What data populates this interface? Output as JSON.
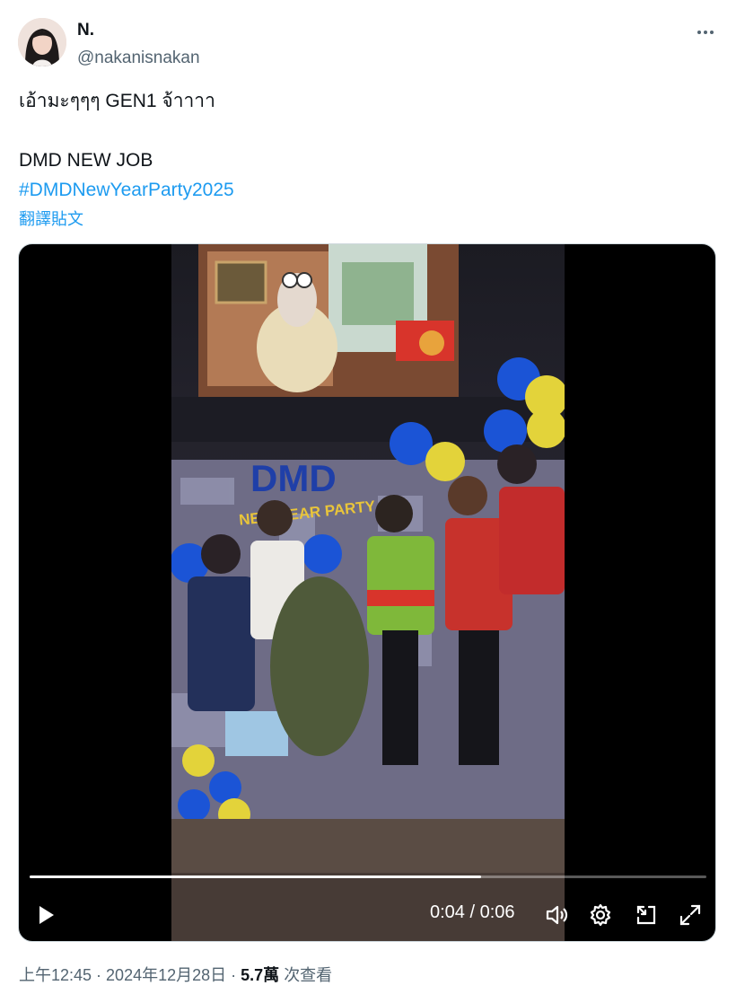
{
  "author": {
    "display_name": "N.",
    "handle": "@nakanisnakan"
  },
  "tweet": {
    "line1": "เอ้ามะๆๆๆ GEN1 จ้าาาา",
    "line2": "DMD NEW JOB",
    "hashtag": "#DMDNewYearParty2025",
    "translate_label": "翻譯貼文"
  },
  "video": {
    "progress": 0.6667,
    "time_display": "0:04 / 0:06",
    "sign_text": "DMD",
    "banner_text": "NEW YEAR PARTY"
  },
  "meta": {
    "time": "上午12:45",
    "separator": " · ",
    "date": "2024年12月28日",
    "views": "5.7萬",
    "views_label": "次查看"
  },
  "colors": {
    "link": "#1d9bf0",
    "secondary_text": "#536471",
    "primary_text": "#0f1419"
  },
  "icons": {
    "more": "more-icon",
    "play": "play-icon",
    "volume": "volume-icon",
    "settings": "gear-icon",
    "pip": "pip-icon",
    "fullscreen": "fullscreen-icon"
  }
}
